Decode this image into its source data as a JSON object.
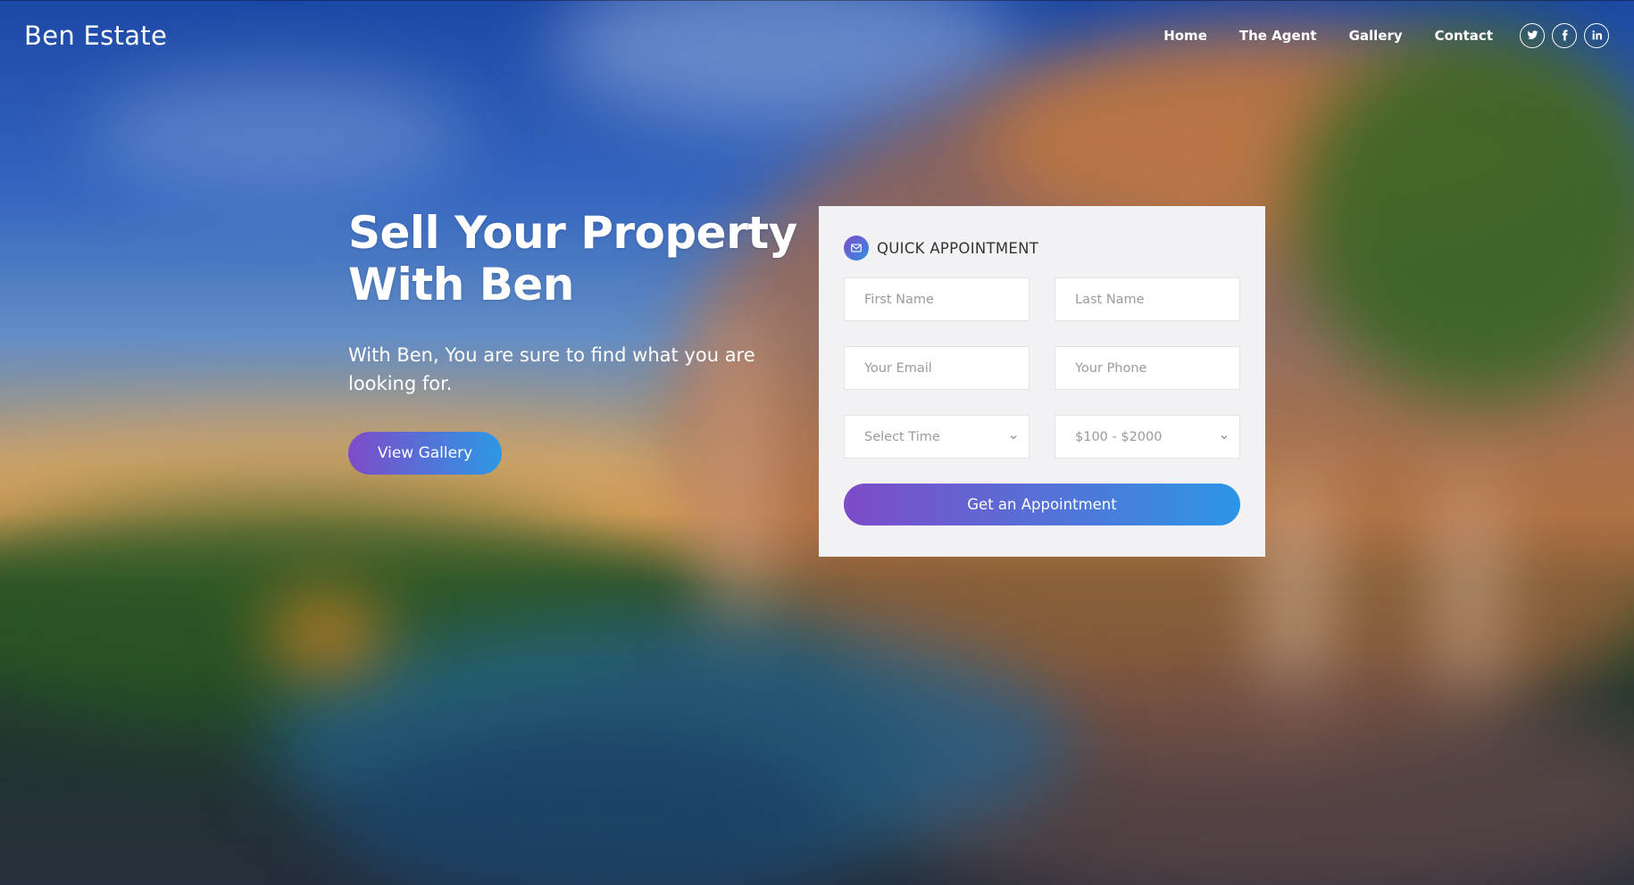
{
  "brand": {
    "name": "Ben Estate"
  },
  "nav": {
    "items": [
      "Home",
      "The Agent",
      "Gallery",
      "Contact"
    ],
    "social": [
      "twitter-icon",
      "facebook-icon",
      "linkedin-icon"
    ]
  },
  "hero": {
    "title_line1": "Sell Your Property",
    "title_line2": "With Ben",
    "subtitle": "With Ben, You are sure to find what you are looking for.",
    "cta": "View Gallery"
  },
  "appointment": {
    "title": "QUICK APPOINTMENT",
    "first_name_placeholder": "First Name",
    "last_name_placeholder": "Last Name",
    "email_placeholder": "Your Email",
    "phone_placeholder": "Your Phone",
    "time_select": "Select Time",
    "budget_select": "$100 - $2000",
    "submit": "Get an Appointment"
  },
  "colors": {
    "gradient_start": "#7e4bc8",
    "gradient_end": "#2c98e6",
    "card_bg": "#f2f2f4"
  }
}
